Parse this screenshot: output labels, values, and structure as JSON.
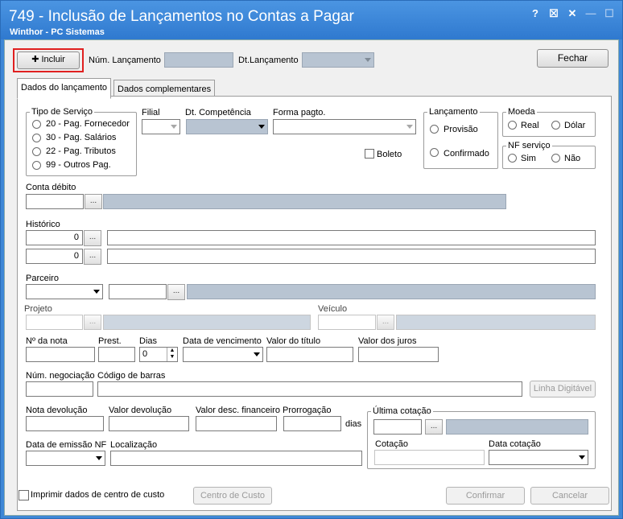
{
  "window": {
    "title": "749 - Inclusão de Lançamentos no Contas a Pagar",
    "subtitle": "Winthor - PC Sistemas",
    "btn_help": "?",
    "btn_edit": "☒",
    "btn_close": "✕",
    "btn_min": "—",
    "btn_max": "☐"
  },
  "toolbar": {
    "incluir": "Incluir",
    "num_lancamento_label": "Núm. Lançamento",
    "dt_lancamento_label": "Dt.Lançamento",
    "fechar": "Fechar"
  },
  "tabs": {
    "dados_lancamento": "Dados do lançamento",
    "dados_complementares": "Dados complementares"
  },
  "tipo_servico": {
    "label": "Tipo de Serviço",
    "options": [
      "20 - Pag. Fornecedor",
      "30 - Pag. Salários",
      "22 - Pag. Tributos",
      "99 - Outros Pag."
    ]
  },
  "fields": {
    "filial": "Filial",
    "dt_competencia": "Dt. Competência",
    "forma_pagto": "Forma pagto.",
    "boleto": "Boleto",
    "conta_debito": "Conta débito",
    "historico": "Histórico",
    "historico_val1": "0",
    "historico_val2": "0",
    "parceiro": "Parceiro",
    "projeto": "Projeto",
    "veiculo": "Veículo",
    "nro_nota": "Nº da nota",
    "prest": "Prest.",
    "dias": "Dias",
    "dias_val": "0",
    "data_vencimento": "Data de vencimento",
    "valor_titulo": "Valor do título",
    "valor_juros": "Valor dos juros",
    "num_negociacao": "Núm. negociação",
    "codigo_barras": "Código de barras",
    "linha_digitavel": "Linha Digitável",
    "nota_devolucao": "Nota devolução",
    "valor_devolucao": "Valor devolução",
    "valor_desc_financeiro": "Valor desc. financeiro",
    "prorrogacao": "Prorrogação",
    "dias_suffix": "dias",
    "data_emissao_nf": "Data de emissão NF",
    "localizacao": "Localização",
    "dots": "..."
  },
  "lancamento": {
    "label": "Lançamento",
    "provisao": "Provisão",
    "confirmado": "Confirmado"
  },
  "moeda": {
    "label": "Moeda",
    "real": "Real",
    "dolar": "Dólar"
  },
  "nf_servico": {
    "label": "NF serviço",
    "sim": "Sim",
    "nao": "Não"
  },
  "ultima_cotacao": {
    "label": "Última cotação",
    "cotacao": "Cotação",
    "data_cotacao": "Data cotação"
  },
  "footer": {
    "imprimir_cc": "Imprimir dados de centro de custo",
    "centro_custo": "Centro de Custo",
    "confirmar": "Confirmar",
    "cancelar": "Cancelar"
  }
}
